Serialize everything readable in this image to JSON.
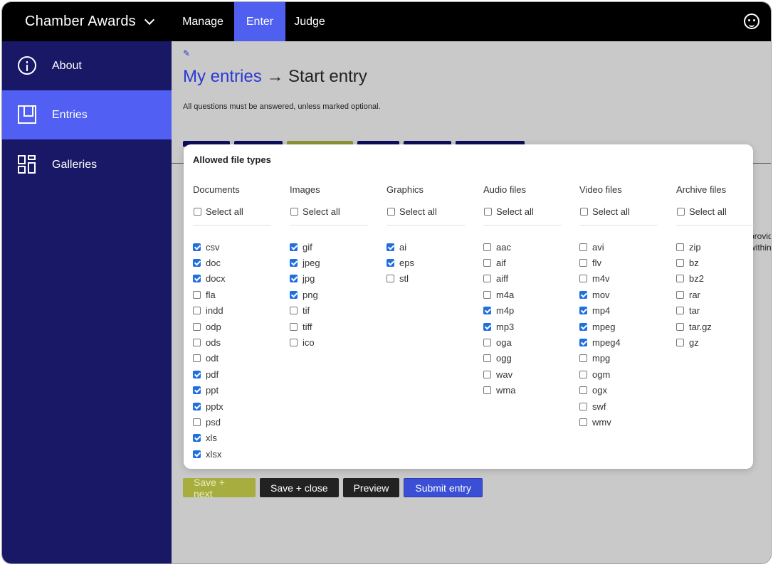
{
  "header": {
    "brand": "Chamber Awards",
    "tabs": [
      {
        "label": "Manage",
        "active": false
      },
      {
        "label": "Enter",
        "active": true
      },
      {
        "label": "Judge",
        "active": false
      }
    ]
  },
  "sidebar": {
    "items": [
      {
        "label": "About",
        "icon": "info-icon",
        "active": false
      },
      {
        "label": "Entries",
        "icon": "bookmark-icon",
        "active": true
      },
      {
        "label": "Galleries",
        "icon": "gallery-grid-icon",
        "active": false
      }
    ]
  },
  "main": {
    "breadcrumb_link": "My entries",
    "breadcrumb_separator": "→",
    "breadcrumb_current": "Start entry",
    "hint": "All questions must be answered, unless marked optional.",
    "cut_text": [
      "provid",
      "within"
    ],
    "buttons": {
      "save_next": "Save + next",
      "save_close": "Save + close",
      "preview": "Preview",
      "submit": "Submit entry"
    }
  },
  "modal": {
    "title": "Allowed file types",
    "select_all_label": "Select all",
    "columns": [
      {
        "heading": "Documents",
        "items": [
          {
            "label": "csv",
            "checked": true
          },
          {
            "label": "doc",
            "checked": true
          },
          {
            "label": "docx",
            "checked": true
          },
          {
            "label": "fla",
            "checked": false
          },
          {
            "label": "indd",
            "checked": false
          },
          {
            "label": "odp",
            "checked": false
          },
          {
            "label": "ods",
            "checked": false
          },
          {
            "label": "odt",
            "checked": false
          },
          {
            "label": "pdf",
            "checked": true
          },
          {
            "label": "ppt",
            "checked": true
          },
          {
            "label": "pptx",
            "checked": true
          },
          {
            "label": "psd",
            "checked": false
          },
          {
            "label": "xls",
            "checked": true
          },
          {
            "label": "xlsx",
            "checked": true
          }
        ]
      },
      {
        "heading": "Images",
        "items": [
          {
            "label": "gif",
            "checked": true
          },
          {
            "label": "jpeg",
            "checked": true
          },
          {
            "label": "jpg",
            "checked": true
          },
          {
            "label": "png",
            "checked": true
          },
          {
            "label": "tif",
            "checked": false
          },
          {
            "label": "tiff",
            "checked": false
          },
          {
            "label": "ico",
            "checked": false
          }
        ]
      },
      {
        "heading": "Graphics",
        "items": [
          {
            "label": "ai",
            "checked": true
          },
          {
            "label": "eps",
            "checked": true
          },
          {
            "label": "stl",
            "checked": false
          }
        ]
      },
      {
        "heading": "Audio files",
        "items": [
          {
            "label": "aac",
            "checked": false
          },
          {
            "label": "aif",
            "checked": false
          },
          {
            "label": "aiff",
            "checked": false
          },
          {
            "label": "m4a",
            "checked": false
          },
          {
            "label": "m4p",
            "checked": true
          },
          {
            "label": "mp3",
            "checked": true
          },
          {
            "label": "oga",
            "checked": false
          },
          {
            "label": "ogg",
            "checked": false
          },
          {
            "label": "wav",
            "checked": false
          },
          {
            "label": "wma",
            "checked": false
          }
        ]
      },
      {
        "heading": "Video files",
        "items": [
          {
            "label": "avi",
            "checked": false
          },
          {
            "label": "flv",
            "checked": false
          },
          {
            "label": "m4v",
            "checked": false
          },
          {
            "label": "mov",
            "checked": true
          },
          {
            "label": "mp4",
            "checked": true
          },
          {
            "label": "mpeg",
            "checked": true
          },
          {
            "label": "mpeg4",
            "checked": true
          },
          {
            "label": "mpg",
            "checked": false
          },
          {
            "label": "ogm",
            "checked": false
          },
          {
            "label": "ogx",
            "checked": false
          },
          {
            "label": "swf",
            "checked": false
          },
          {
            "label": "wmv",
            "checked": false
          }
        ]
      },
      {
        "heading": "Archive files",
        "items": [
          {
            "label": "zip",
            "checked": false
          },
          {
            "label": "bz",
            "checked": false
          },
          {
            "label": "bz2",
            "checked": false
          },
          {
            "label": "rar",
            "checked": false
          },
          {
            "label": "tar",
            "checked": false
          },
          {
            "label": "tar.gz",
            "checked": false
          },
          {
            "label": "gz",
            "checked": false
          }
        ]
      }
    ]
  }
}
